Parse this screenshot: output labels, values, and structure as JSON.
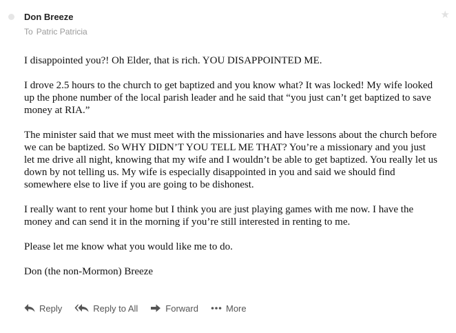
{
  "message": {
    "sender": "Don Breeze",
    "to_prefix": "To",
    "recipient": "Patric Patricia",
    "paragraphs": [
      "I disappointed you?! Oh Elder, that is rich. YOU DISAPPOINTED ME.",
      "I drove 2.5 hours to the church to get baptized and you know what? It was locked! My wife looked up the phone number of the local parish leader and he said that “you just can’t get baptized to save money at RIA.”",
      "The minister said that we must meet with the missionaries and have lessons about the church before we can be baptized. So WHY DIDN’T YOU TELL ME THAT? You’re a missionary and you just let me drive all night, knowing that my wife and I wouldn’t be able to get baptized. You really let us down by not telling us. My wife is especially disappointed in you and said we should find somewhere else to live if you are going to be dishonest.",
      "I really want to rent your home but I think you are just playing games with me now. I have the money and can send it in the morning if you’re still interested in renting to me.",
      "Please let me know what you would like me to do.",
      "Don (the non-Mormon) Breeze"
    ]
  },
  "actions": {
    "reply": "Reply",
    "reply_all": "Reply to All",
    "forward": "Forward",
    "more": "More"
  },
  "icons": {
    "unread": "unread-dot-icon",
    "star": "star-icon",
    "reply": "reply-arrow-icon",
    "reply_all": "reply-all-arrow-icon",
    "forward": "forward-arrow-icon",
    "more": "ellipsis-icon"
  },
  "colors": {
    "accent_text": "#555555",
    "muted_text": "#9a9a9a",
    "star": "#e2e2e2"
  }
}
